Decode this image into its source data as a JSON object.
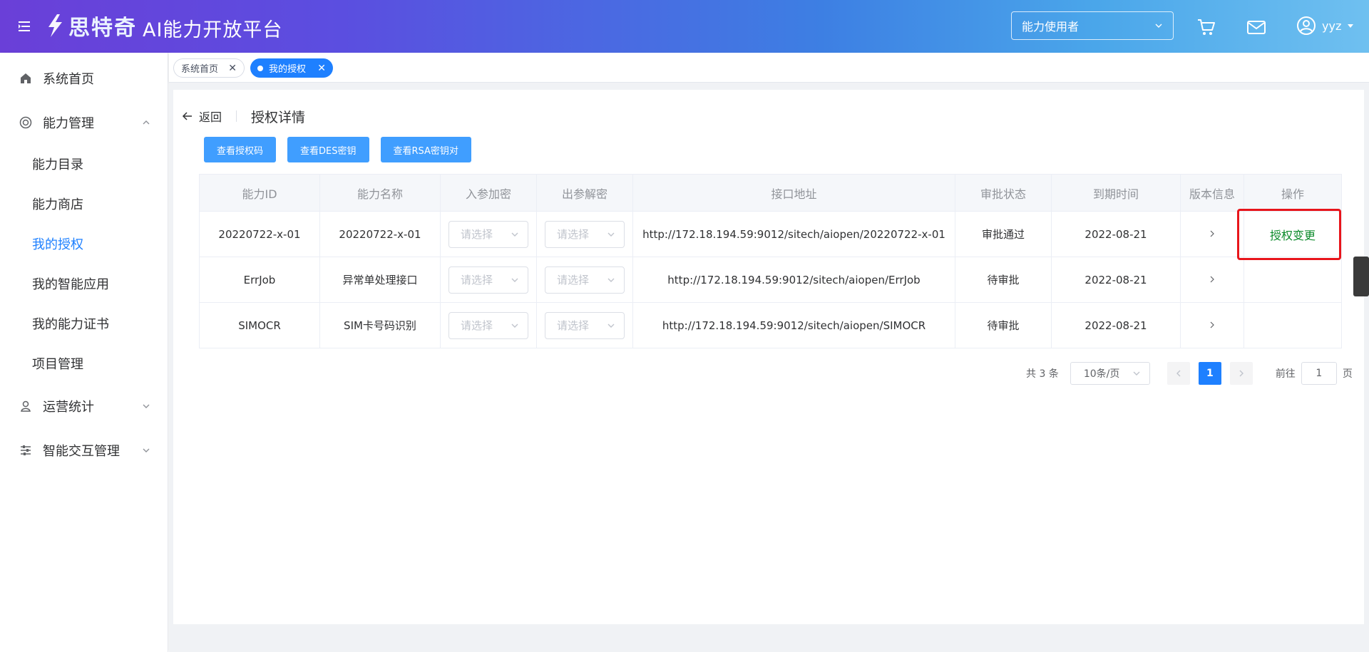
{
  "header": {
    "logo_text": "思特奇",
    "platform_title": "AI能力开放平台",
    "role_select_value": "能力使用者",
    "username": "yyz"
  },
  "sidebar": {
    "items": [
      {
        "label": "系统首页",
        "icon": "home-icon"
      },
      {
        "label": "能力管理",
        "icon": "ability-icon",
        "expanded": true
      },
      {
        "label": "能力目录"
      },
      {
        "label": "能力商店"
      },
      {
        "label": "我的授权",
        "active": true
      },
      {
        "label": "我的智能应用"
      },
      {
        "label": "我的能力证书"
      },
      {
        "label": "项目管理"
      },
      {
        "label": "运营统计",
        "icon": "stats-icon"
      },
      {
        "label": "智能交互管理",
        "icon": "sliders-icon"
      }
    ]
  },
  "tabs": [
    {
      "label": "系统首页",
      "active": false
    },
    {
      "label": "我的授权",
      "active": true
    }
  ],
  "page": {
    "back_label": "返回",
    "title": "授权详情",
    "buttons": [
      "查看授权码",
      "查看DES密钥",
      "查看RSA密钥对"
    ]
  },
  "table": {
    "headers": [
      "能力ID",
      "能力名称",
      "入参加密",
      "出参解密",
      "接口地址",
      "审批状态",
      "到期时间",
      "版本信息",
      "操作"
    ],
    "select_placeholder": "请选择",
    "rows": [
      {
        "id": "20220722-x-01",
        "name": "20220722-x-01",
        "url": "http://172.18.194.59:9012/sitech/aiopen/20220722-x-01",
        "status": "审批通过",
        "expire": "2022-08-21",
        "action": "授权变更"
      },
      {
        "id": "ErrJob",
        "name": "异常单处理接口",
        "url": "http://172.18.194.59:9012/sitech/aiopen/ErrJob",
        "status": "待审批",
        "expire": "2022-08-21",
        "action": ""
      },
      {
        "id": "SIMOCR",
        "name": "SIM卡号码识别",
        "url": "http://172.18.194.59:9012/sitech/aiopen/SIMOCR",
        "status": "待审批",
        "expire": "2022-08-21",
        "action": ""
      }
    ]
  },
  "pagination": {
    "total": "共 3 条",
    "page_size": "10条/页",
    "current_page": "1",
    "goto_label": "前往",
    "goto_value": "1",
    "page_suffix": "页"
  },
  "colors": {
    "primary": "#1e80ff",
    "button": "#409eff",
    "action_link": "#0b8a2a",
    "highlight": "#e8151b"
  }
}
